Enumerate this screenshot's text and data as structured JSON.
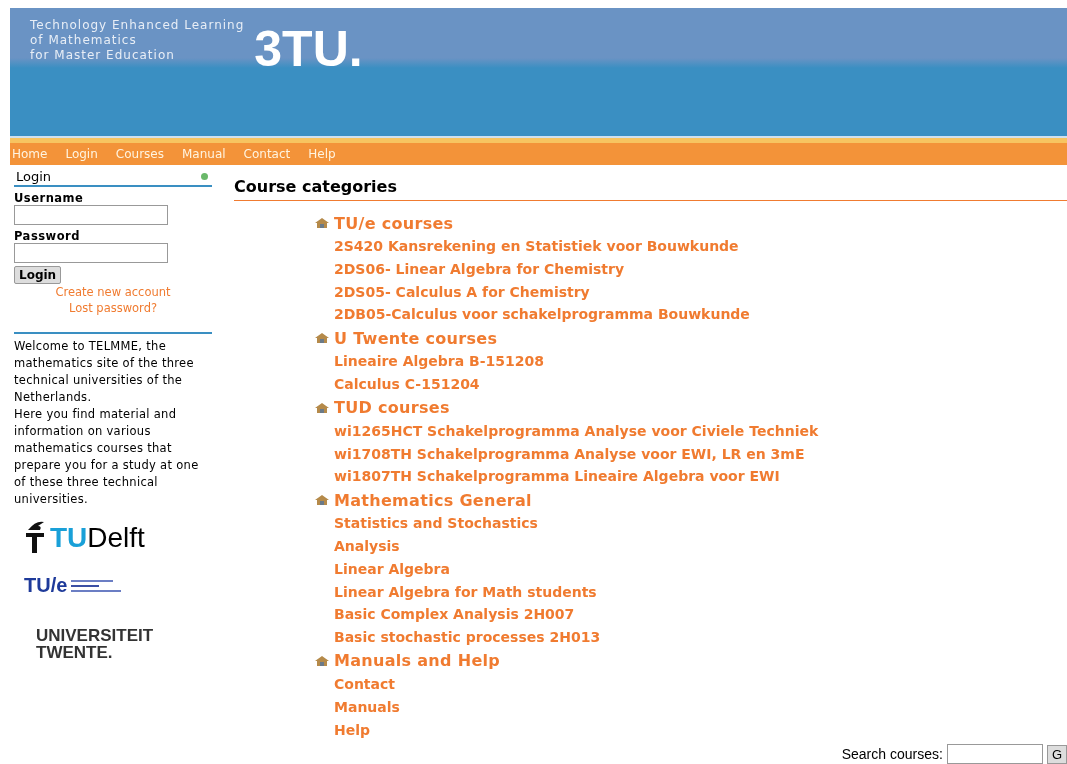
{
  "header": {
    "tagline": [
      "Technology Enhanced Learning",
      "of Mathematics",
      "for Master Education"
    ],
    "logo": "3TU."
  },
  "nav": [
    "Home",
    "Login",
    "Courses",
    "Manual",
    "Contact",
    "Help"
  ],
  "login": {
    "title": "Login",
    "username_label": "Username",
    "password_label": "Password",
    "button": "Login",
    "links": [
      "Create new account",
      "Lost password?"
    ]
  },
  "welcome": "Welcome to TELMME, the mathematics site of the three technical universities of the Netherlands.\nHere you find material and information on various mathematics courses that prepare you for a study at one of these three technical universities.",
  "partners": [
    {
      "kind": "delft",
      "accent": "TU",
      "text": "Delft"
    },
    {
      "kind": "tue",
      "text": "TU/e"
    },
    {
      "kind": "twente",
      "text": "UNIVERSITEIT\nTWENTE."
    }
  ],
  "main": {
    "title": "Course categories",
    "categories": [
      {
        "name": "TU/e courses",
        "courses": [
          "2S420 Kansrekening en Statistiek voor Bouwkunde",
          "2DS06- Linear Algebra for Chemistry",
          "2DS05- Calculus A for Chemistry",
          "2DB05-Calculus voor schakelprogramma Bouwkunde"
        ]
      },
      {
        "name": "U Twente courses",
        "courses": [
          "Lineaire Algebra B-151208",
          "Calculus C-151204"
        ]
      },
      {
        "name": "TUD courses",
        "courses": [
          "wi1265HCT Schakelprogramma Analyse voor Civiele Techniek",
          "wi1708TH Schakelprogramma Analyse voor EWI, LR en 3mE",
          "wi1807TH Schakelprogramma Lineaire Algebra voor EWI"
        ]
      },
      {
        "name": "Mathematics General",
        "courses": [
          "Statistics and Stochastics",
          "Analysis",
          "Linear Algebra",
          "Linear Algebra for Math students",
          "Basic Complex Analysis 2H007",
          "Basic stochastic processes 2H013"
        ]
      },
      {
        "name": "Manuals and Help",
        "courses": [
          "Contact",
          "Manuals",
          "Help"
        ]
      }
    ]
  },
  "search": {
    "label": "Search courses:",
    "button": "G"
  }
}
